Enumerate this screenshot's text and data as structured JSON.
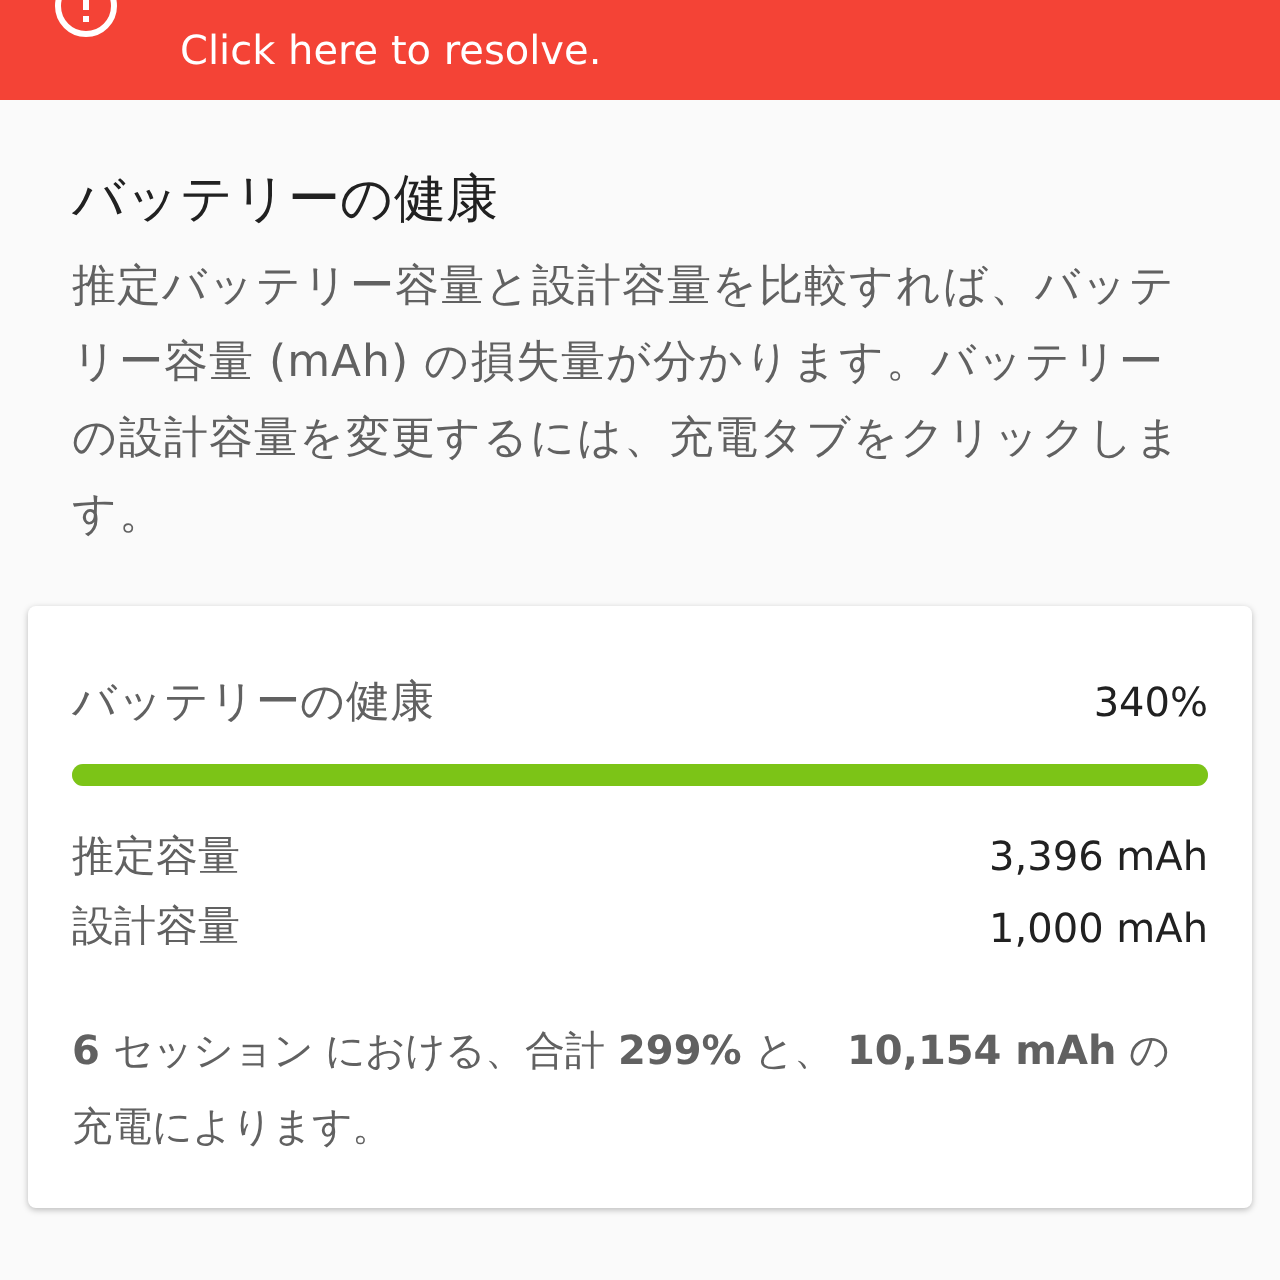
{
  "alert": {
    "message": "Click here to resolve."
  },
  "section": {
    "title": "バッテリーの健康",
    "description": "推定バッテリー容量と設計容量を比較すれば、バッテリー容量 (mAh) の損失量が分かります。バッテリーの設計容量を変更するには、充電タブをクリックします。"
  },
  "card": {
    "label": "バッテリーの健康",
    "value": "340%",
    "level": 1,
    "rows": [
      {
        "label": "推定容量",
        "value": "3,396 mAh"
      },
      {
        "label": "設計容量",
        "value": "1,000 mAh"
      }
    ],
    "summary": "**6** セッション における、合計 **299%** と、 **10,154 mAh** の充電によります。"
  }
}
